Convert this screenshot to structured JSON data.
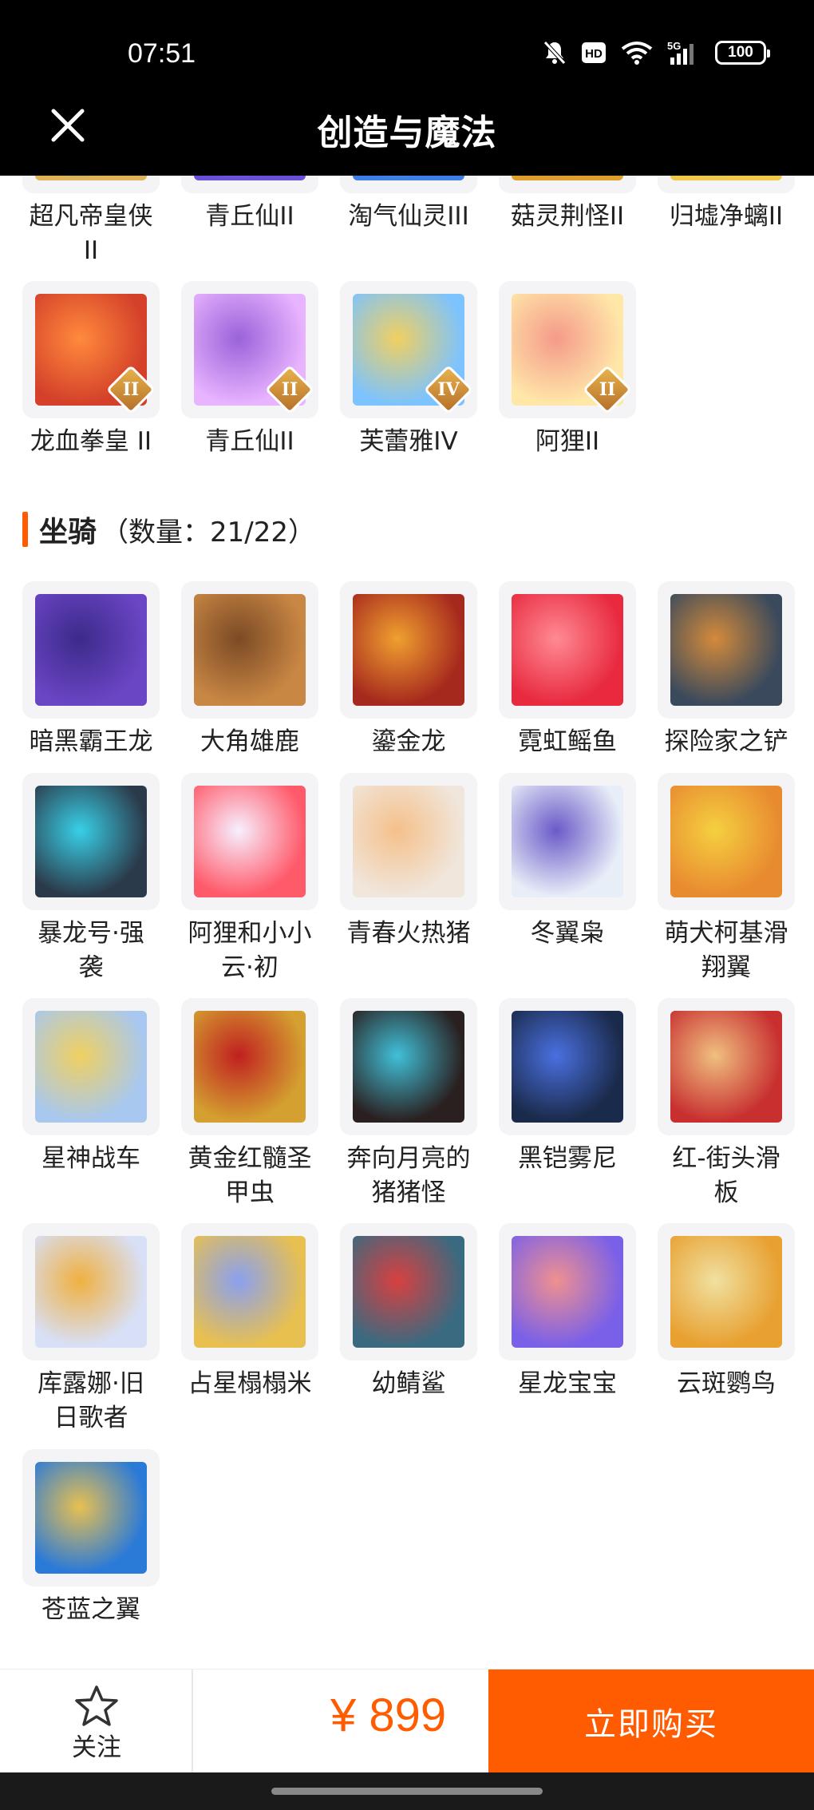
{
  "status_bar": {
    "time": "07:51",
    "battery": "100",
    "network": "5G"
  },
  "header": {
    "title": "创造与魔法",
    "close_icon": "close-icon"
  },
  "top_items": [
    {
      "label": "超凡帝皇侠\nII",
      "colors": [
        "#e0b35a",
        "#7a5df0"
      ]
    },
    {
      "label": "青丘仙II",
      "colors": [
        "#6b4fd8",
        "#c7b3ff"
      ]
    },
    {
      "label": "淘气仙灵III",
      "colors": [
        "#3e7fe5",
        "#90d4ff"
      ]
    },
    {
      "label": "菇灵荆怪II",
      "colors": [
        "#e09f2c",
        "#a05be6"
      ]
    },
    {
      "label": "归墟净螭II",
      "colors": [
        "#f2c84a",
        "#66cfe8"
      ]
    }
  ],
  "skin_items": [
    {
      "label": "龙血拳皇 II",
      "badge": "II",
      "colors": [
        "#d4402a",
        "#ff8a3c"
      ]
    },
    {
      "label": "青丘仙II",
      "badge": "II",
      "colors": [
        "#e8b3ff",
        "#9a62d9"
      ]
    },
    {
      "label": "芙蕾雅IV",
      "badge": "IV",
      "colors": [
        "#7cc3ff",
        "#f0d060"
      ]
    },
    {
      "label": "阿狸II",
      "badge": "II",
      "colors": [
        "#ffe7a8",
        "#f59a8a"
      ]
    }
  ],
  "mounts_section": {
    "title": "坐骑",
    "count": "（数量：21/22）"
  },
  "mounts": [
    {
      "label": "暗黑霸王龙",
      "colors": [
        "#6a45c4",
        "#3c2a8a"
      ]
    },
    {
      "label": "大角雄鹿",
      "colors": [
        "#c98744",
        "#7b4a25"
      ]
    },
    {
      "label": "鎏金龙",
      "colors": [
        "#a6291d",
        "#f0a030"
      ]
    },
    {
      "label": "霓虹鳐鱼",
      "colors": [
        "#e8293e",
        "#ff8a94"
      ]
    },
    {
      "label": "探险家之铲",
      "colors": [
        "#3a4a5c",
        "#d58a3a"
      ]
    },
    {
      "label": "暴龙号·强\n袭",
      "colors": [
        "#2b3a4a",
        "#38d0e8"
      ]
    },
    {
      "label": "阿狸和小小\n云·初",
      "colors": [
        "#ff5a6a",
        "#f7f0ff"
      ]
    },
    {
      "label": "青春火热猪",
      "colors": [
        "#f0e6dc",
        "#f5c08a"
      ]
    },
    {
      "label": "冬翼枭",
      "colors": [
        "#e8eef8",
        "#6a5ac8"
      ]
    },
    {
      "label": "萌犬柯基滑\n翔翼",
      "colors": [
        "#e88a30",
        "#f5d040"
      ]
    },
    {
      "label": "星神战车",
      "colors": [
        "#a8c8f0",
        "#f0d060"
      ]
    },
    {
      "label": "黄金红髓圣\n甲虫",
      "colors": [
        "#d4a030",
        "#c02020"
      ]
    },
    {
      "label": "奔向月亮的\n猪猪怪",
      "colors": [
        "#2a2020",
        "#40c0d8"
      ]
    },
    {
      "label": "黑铠雾尼",
      "colors": [
        "#1a2a4a",
        "#4a70e0"
      ]
    },
    {
      "label": "红-街头滑\n板",
      "colors": [
        "#c83030",
        "#f0c080"
      ]
    },
    {
      "label": "库露娜·旧\n日歌者",
      "colors": [
        "#d8e0f8",
        "#f0b040"
      ]
    },
    {
      "label": "占星榻榻米",
      "colors": [
        "#e8c050",
        "#8aa0f0"
      ]
    },
    {
      "label": "幼鲭鲨",
      "colors": [
        "#3a6a80",
        "#d84040"
      ]
    },
    {
      "label": "星龙宝宝",
      "colors": [
        "#7a60e8",
        "#f09090"
      ]
    },
    {
      "label": "云斑鹦鸟",
      "colors": [
        "#e8a030",
        "#f0e0a0"
      ]
    },
    {
      "label": "苍蓝之翼",
      "colors": [
        "#2a7ad8",
        "#e8c050"
      ]
    }
  ],
  "footer": {
    "follow_label": "关注",
    "follow_icon": "star-icon",
    "price": "¥ 899",
    "buy_label": "立即购买"
  },
  "colors": {
    "accent": "#ff5b00",
    "header_bg": "#000000",
    "thumb_bg": "#f4f4f6"
  }
}
